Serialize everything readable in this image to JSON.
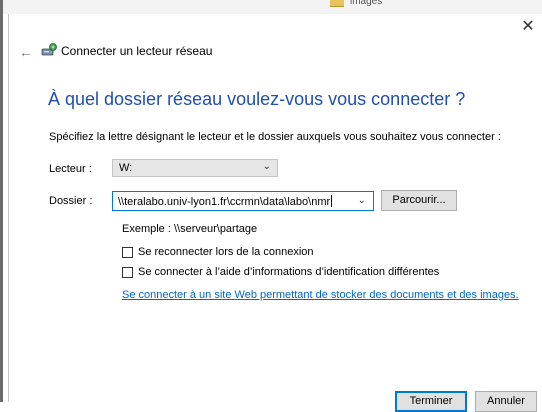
{
  "background": {
    "partial_label": "images"
  },
  "window": {
    "close_label": "✕",
    "back_label": "←",
    "title": "Connecter un lecteur réseau",
    "title_icon": "network-drive-icon"
  },
  "content": {
    "heading": "À quel dossier réseau voulez-vous vous connecter ?",
    "instructions": "Spécifiez la lettre désignant le lecteur et le dossier auxquels vous souhaitez vous connecter :"
  },
  "form": {
    "drive_label": "Lecteur :",
    "drive_value": "W:",
    "folder_label": "Dossier :",
    "folder_value": "\\\\teralabo.univ-lyon1.fr\\ccrmn\\data\\labo\\nmr",
    "browse_label": "Parcourir...",
    "example": "Exemple : \\\\serveur\\partage",
    "reconnect_label": "Se reconnecter lors de la connexion",
    "reconnect_checked": false,
    "other_credentials_label": "Se connecter à l’aide d’informations d’identification différentes",
    "other_credentials_checked": false,
    "web_link": "Se connecter à un site Web permettant de stocker des documents et des images."
  },
  "footer": {
    "finish_label": "Terminer",
    "cancel_label": "Annuler"
  },
  "colors": {
    "heading": "#1f4eb4",
    "link": "#0066cc",
    "focus": "#0078d7"
  }
}
